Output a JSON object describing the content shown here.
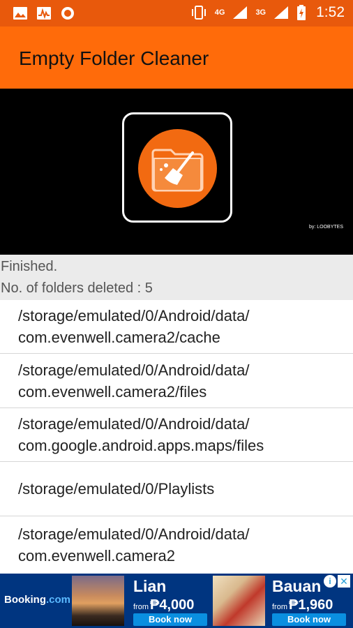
{
  "status_bar": {
    "time": "1:52",
    "network_1": "4G",
    "network_2": "3G",
    "icons_left": [
      "image-icon",
      "activity-icon",
      "record-icon"
    ],
    "icons_right": [
      "vibrate-icon",
      "signal-icon",
      "battery-charging-icon"
    ]
  },
  "app_bar": {
    "title": "Empty Folder Cleaner"
  },
  "banner": {
    "credit": "by: LOOBYTES"
  },
  "status": {
    "line1": "Finished.",
    "line2": "No. of folders deleted : 5"
  },
  "folders": [
    "/storage/emulated/0/Android/data/\ncom.evenwell.camera2/cache",
    "/storage/emulated/0/Android/data/\ncom.evenwell.camera2/files",
    "/storage/emulated/0/Android/data/\ncom.google.android.apps.maps/files",
    "/storage/emulated/0/Playlists",
    "/storage/emulated/0/Android/data/\ncom.evenwell.camera2"
  ],
  "ad": {
    "brand": "Booking",
    "brand_suffix": ".com",
    "offers": [
      {
        "city": "Lian",
        "from": "from",
        "price": "₱4,000",
        "button": "Book now"
      },
      {
        "city": "Bauan",
        "from": "from",
        "price": "₱1,960",
        "button": "Book now"
      }
    ],
    "choices_label": "i",
    "close_label": "✕"
  },
  "colors": {
    "status_bar": "#e8590c",
    "app_bar": "#ff6b0a",
    "banner_bg": "#000000",
    "logo_orange": "#f26a11",
    "ad_bg": "#003580",
    "ad_button": "#0a8fe0"
  }
}
